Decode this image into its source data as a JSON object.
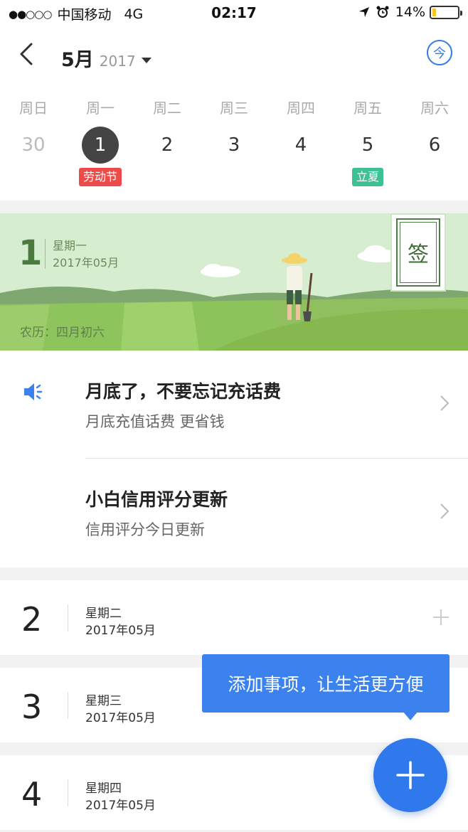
{
  "status_bar": {
    "signal": "●●○○○",
    "carrier": "中国移动",
    "network": "4G",
    "time": "02:17",
    "battery_percent": "14%",
    "battery_level": 0.14,
    "icons": [
      "location-arrow-icon",
      "alarm-clock-icon",
      "battery-icon"
    ]
  },
  "header": {
    "month": "5月",
    "year": "2017",
    "today_label": "今"
  },
  "week": {
    "weekdays": [
      "周日",
      "周一",
      "周二",
      "周三",
      "周四",
      "周五",
      "周六"
    ],
    "days": [
      {
        "num": "30",
        "muted": true,
        "selected": false,
        "tag": ""
      },
      {
        "num": "1",
        "muted": false,
        "selected": true,
        "tag": "劳动节",
        "tag_color": "#ee4a4a"
      },
      {
        "num": "2",
        "muted": false,
        "selected": false,
        "tag": ""
      },
      {
        "num": "3",
        "muted": false,
        "selected": false,
        "tag": ""
      },
      {
        "num": "4",
        "muted": false,
        "selected": false,
        "tag": ""
      },
      {
        "num": "5",
        "muted": false,
        "selected": false,
        "tag": "立夏",
        "tag_color": "#3fbf94"
      },
      {
        "num": "6",
        "muted": false,
        "selected": false,
        "tag": ""
      }
    ]
  },
  "banner": {
    "day": "1",
    "weekday": "星期一",
    "date": "2017年05月",
    "lunar": "农历：四月初六",
    "sign_label": "签"
  },
  "reminders": [
    {
      "title": "月底了，不要忘记充话费",
      "subtitle": "月底充值话费 更省钱",
      "icon": "speaker-icon"
    },
    {
      "title": "小白信用评分更新",
      "subtitle": "信用评分今日更新",
      "icon": ""
    }
  ],
  "day_cards": [
    {
      "num": "2",
      "weekday": "星期二",
      "date": "2017年05月"
    },
    {
      "num": "3",
      "weekday": "星期三",
      "date": "2017年05月"
    },
    {
      "num": "4",
      "weekday": "星期四",
      "date": "2017年05月"
    }
  ],
  "tooltip": {
    "text": "添加事项，让生活更方便"
  },
  "colors": {
    "accent": "#2f79ec",
    "holiday": "#ee4a4a",
    "solar_term": "#3fbf94"
  }
}
